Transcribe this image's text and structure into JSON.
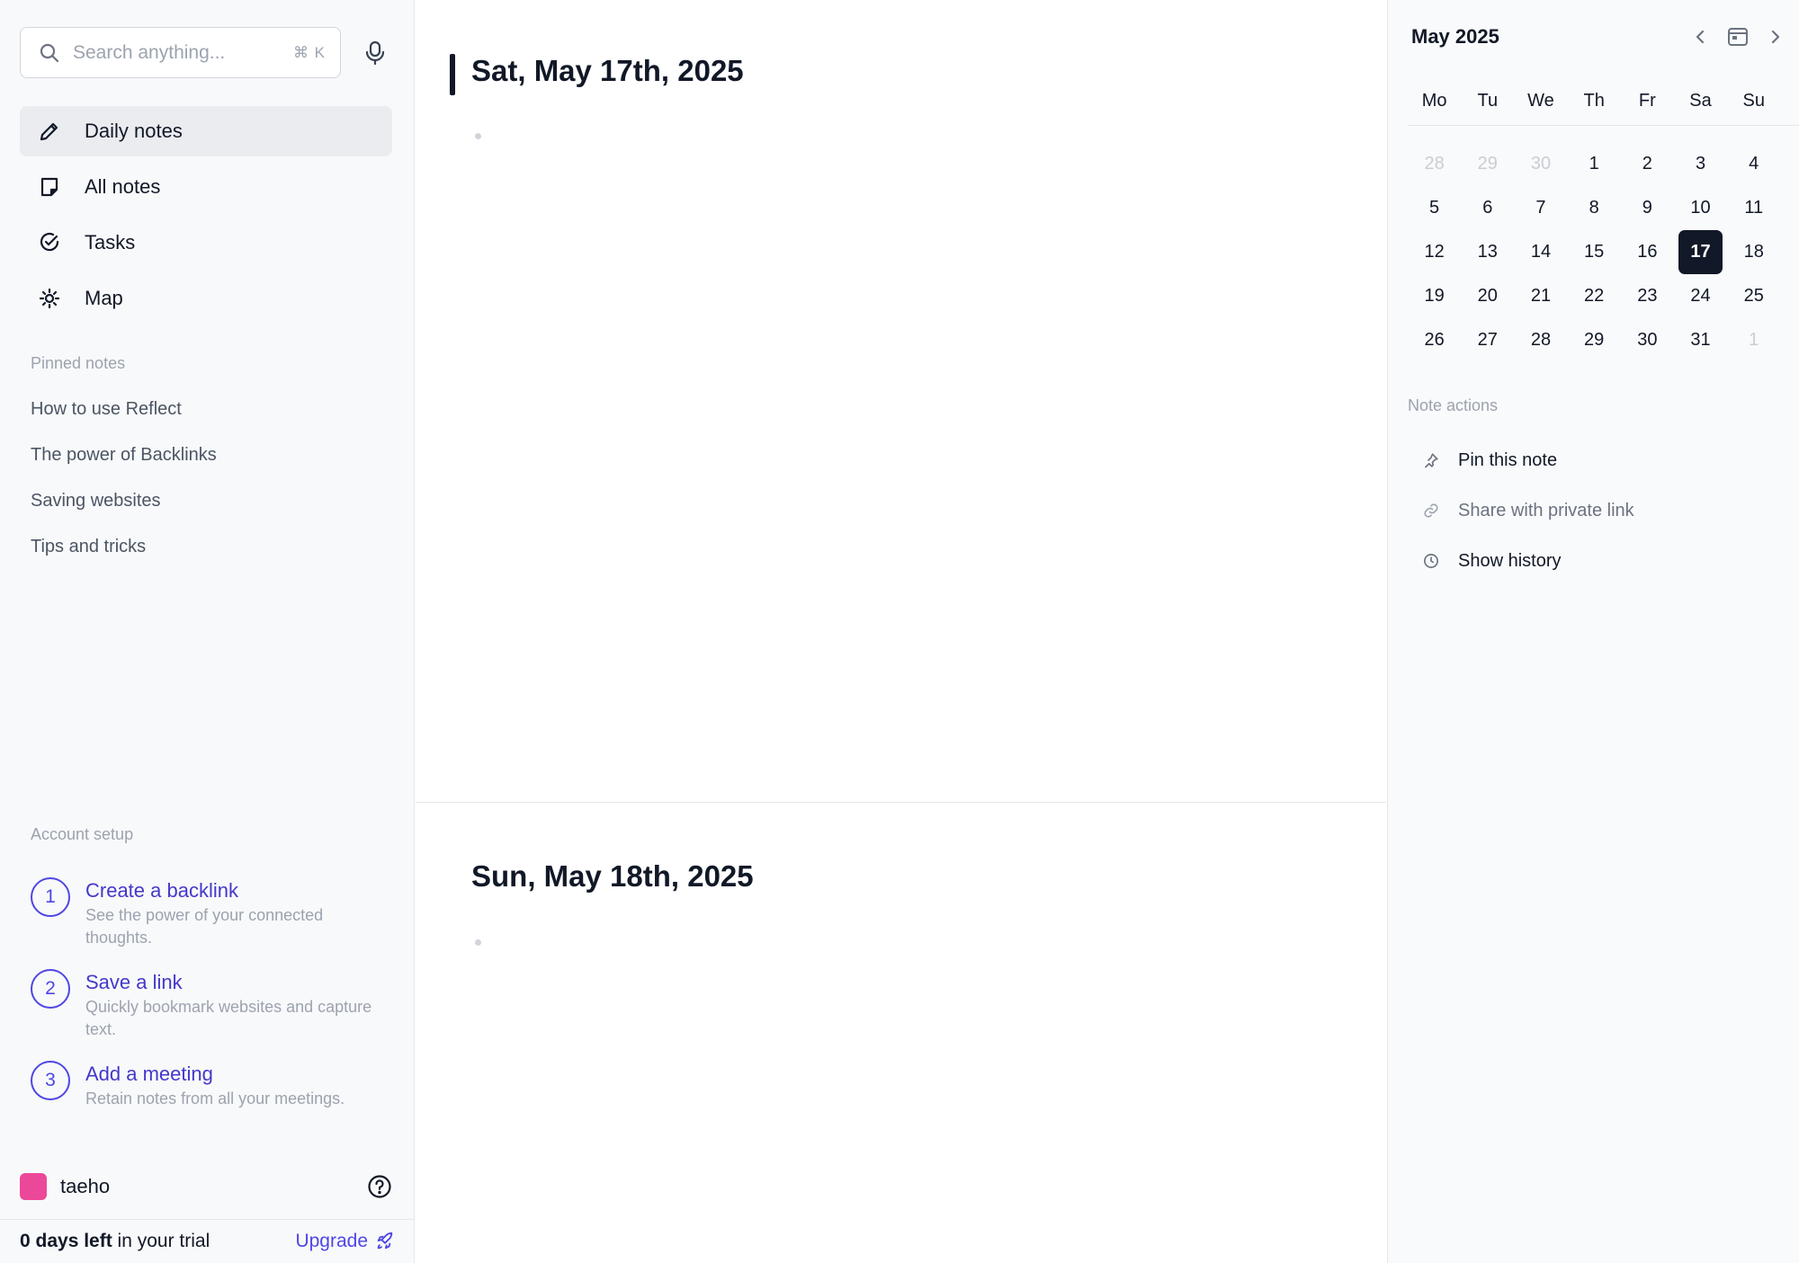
{
  "search": {
    "placeholder": "Search anything...",
    "shortcut": "⌘ K"
  },
  "nav": {
    "items": [
      {
        "label": "Daily notes",
        "icon": "pencil-icon",
        "active": true
      },
      {
        "label": "All notes",
        "icon": "note-icon"
      },
      {
        "label": "Tasks",
        "icon": "check-circle-icon"
      },
      {
        "label": "Map",
        "icon": "map-sun-icon"
      }
    ]
  },
  "pinned": {
    "title": "Pinned notes",
    "items": [
      "How to use Reflect",
      "The power of Backlinks",
      "Saving websites",
      "Tips and tricks"
    ]
  },
  "setup": {
    "title": "Account setup",
    "steps": [
      {
        "num": "1",
        "title": "Create a backlink",
        "desc": "See the power of your connected thoughts."
      },
      {
        "num": "2",
        "title": "Save a link",
        "desc": "Quickly bookmark websites and capture text."
      },
      {
        "num": "3",
        "title": "Add a meeting",
        "desc": "Retain notes from all your meetings."
      }
    ]
  },
  "user": {
    "name": "taeho",
    "avatar_color": "#ec4899"
  },
  "trial": {
    "days_text": "0 days left",
    "suffix": " in your trial",
    "upgrade_label": "Upgrade"
  },
  "notes": [
    {
      "title": "Sat, May 17th, 2025"
    },
    {
      "title": "Sun, May 18th, 2025"
    }
  ],
  "calendar": {
    "month_label": "May 2025",
    "weekdays": [
      "Mo",
      "Tu",
      "We",
      "Th",
      "Fr",
      "Sa",
      "Su"
    ],
    "weeks": [
      [
        "28",
        "29",
        "30",
        "1",
        "2",
        "3",
        "4"
      ],
      [
        "5",
        "6",
        "7",
        "8",
        "9",
        "10",
        "11"
      ],
      [
        "12",
        "13",
        "14",
        "15",
        "16",
        "17",
        "18"
      ],
      [
        "19",
        "20",
        "21",
        "22",
        "23",
        "24",
        "25"
      ],
      [
        "26",
        "27",
        "28",
        "29",
        "30",
        "31",
        "1"
      ]
    ],
    "muted": [
      [
        0,
        0
      ],
      [
        0,
        1
      ],
      [
        0,
        2
      ],
      [
        4,
        6
      ]
    ],
    "selected": [
      2,
      5
    ]
  },
  "note_actions": {
    "title": "Note actions",
    "items": [
      {
        "label": "Pin this note",
        "icon": "pin-icon"
      },
      {
        "label": "Share with private link",
        "icon": "link-icon",
        "dim": true
      },
      {
        "label": "Show history",
        "icon": "clock-icon"
      }
    ]
  },
  "colors": {
    "accent": "#4f46e5",
    "selected_day_bg": "#111827"
  }
}
